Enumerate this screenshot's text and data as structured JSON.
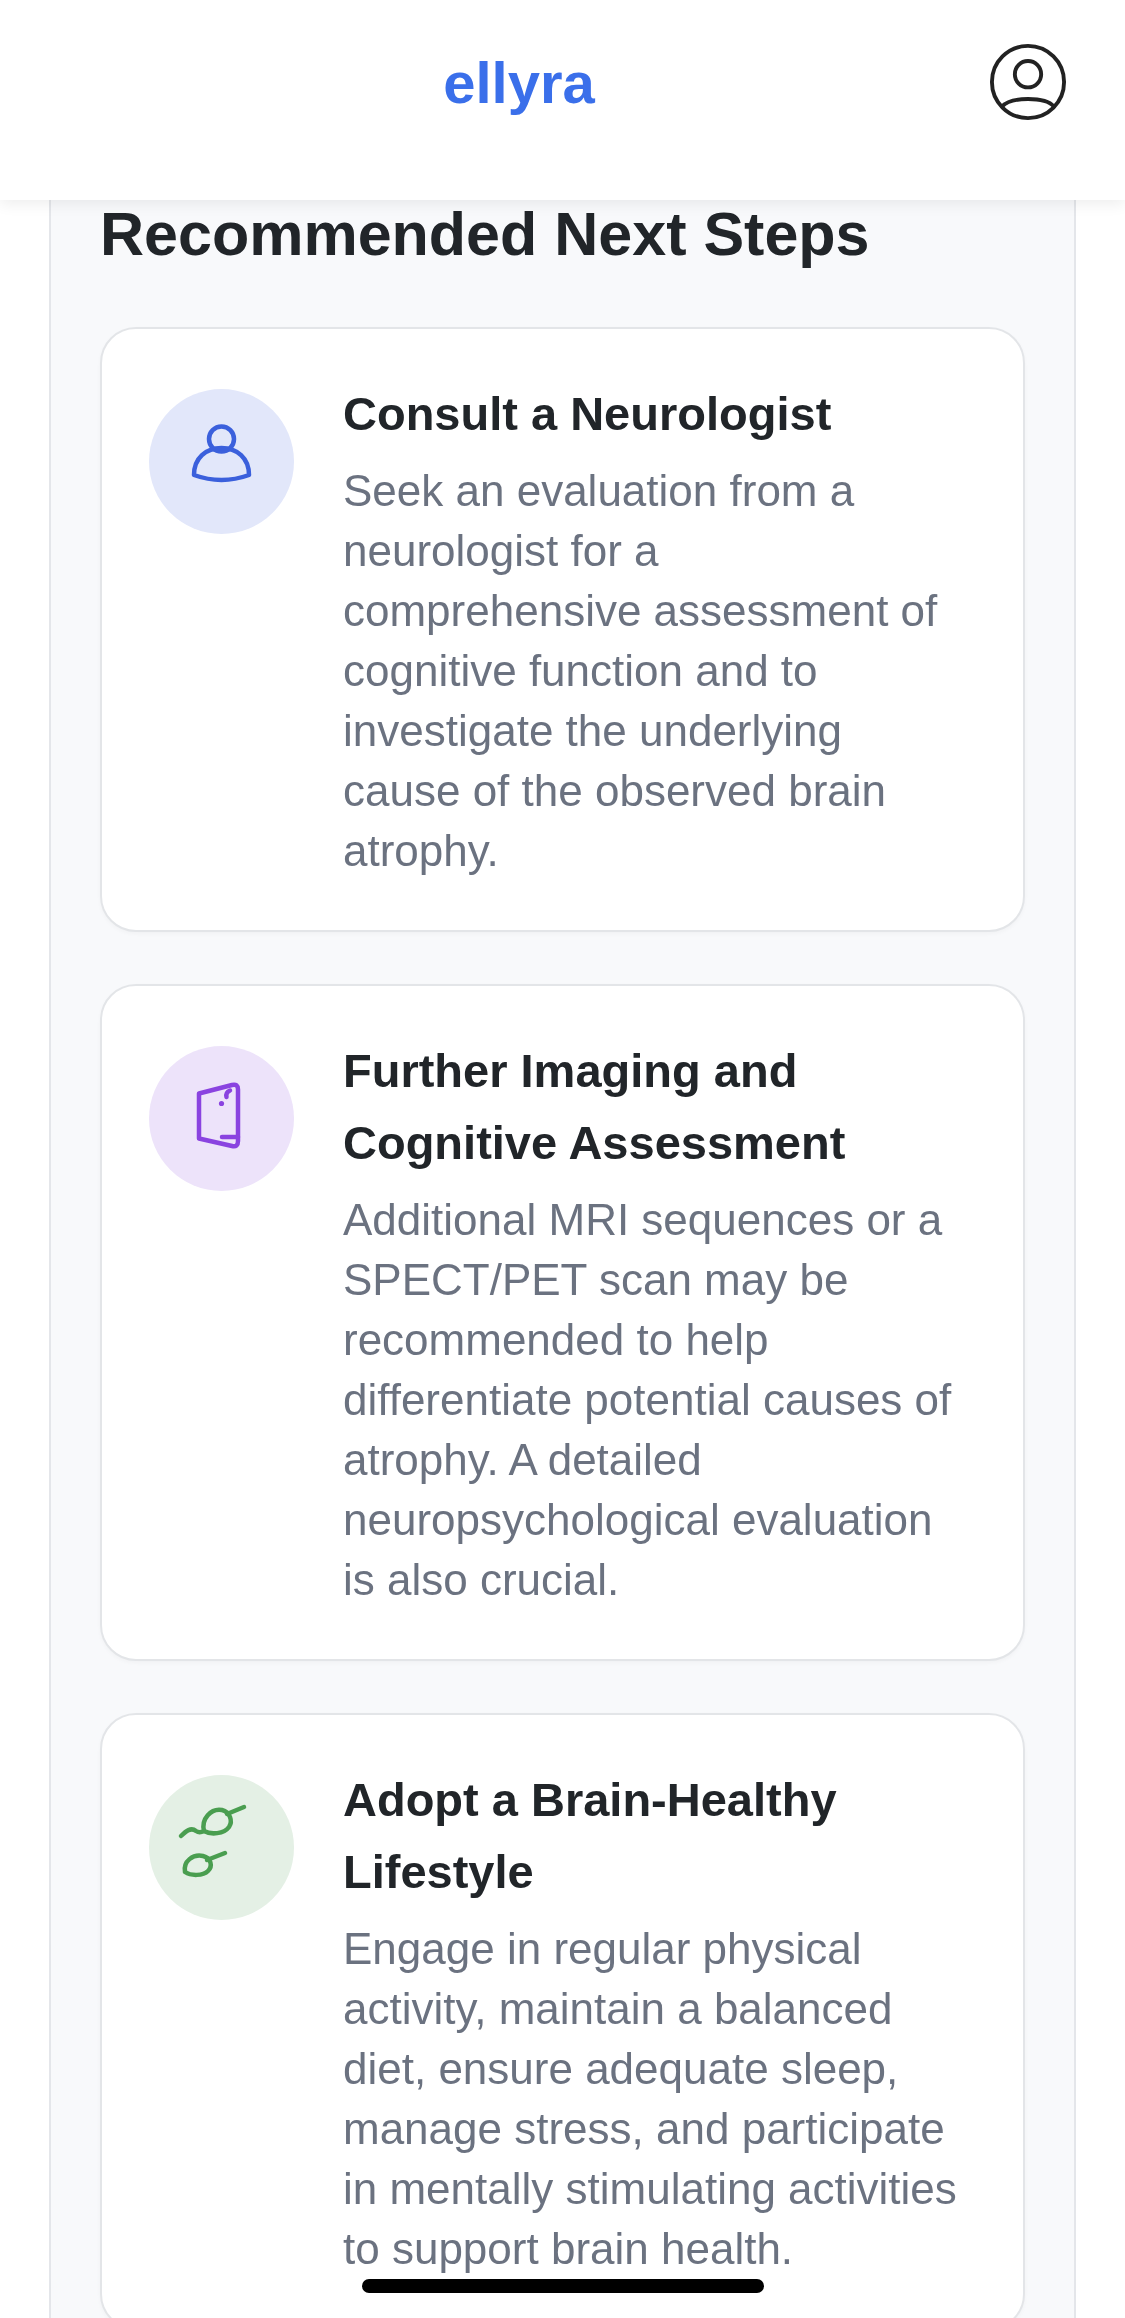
{
  "header": {
    "logo": "ellyra"
  },
  "next_steps": {
    "title": "Recommended Next Steps",
    "steps": [
      {
        "kind": "person",
        "color": "#3b60dc",
        "title": "Consult a Neurologist",
        "description": "Seek an evaluation from a neurologist for a comprehensive assessment of cognitive function and to investigate the underlying cause of the observed brain atrophy."
      },
      {
        "kind": "device",
        "color": "#8a43e0",
        "title": "Further Imaging and Cognitive Assessment",
        "description": "Additional MRI sequences or a SPECT/PET scan may be recommended to help differentiate potential causes of atrophy. A detailed neuropsychological evaluation is also crucial."
      },
      {
        "kind": "leaves",
        "color": "#4a9e50",
        "title": "Adopt a Brain-Healthy Lifestyle",
        "description": "Engage in regular physical activity, maintain a balanced diet, ensure adequate sleep, manage stress, and participate in mentally stimulating activities to support brain health."
      }
    ]
  }
}
